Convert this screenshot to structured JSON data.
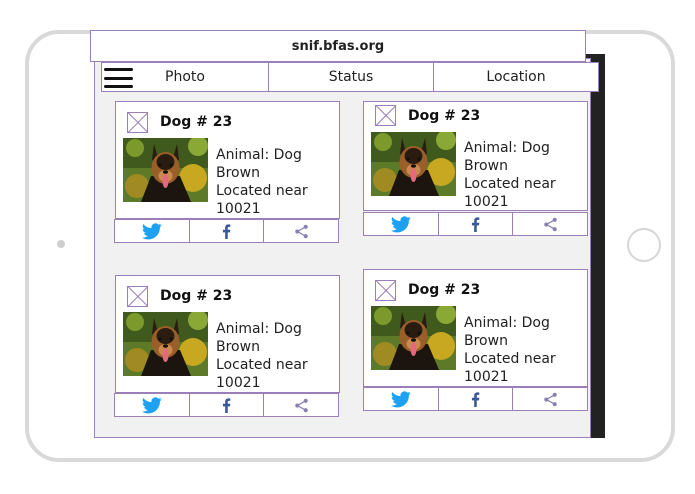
{
  "browser": {
    "url": "snif.bfas.org"
  },
  "nav": {
    "menu_icon": "hamburger-menu-icon",
    "tabs": [
      "Photo",
      "Status",
      "Location"
    ]
  },
  "cards": [
    {
      "title": "Dog # 23",
      "animal": "Animal: Dog",
      "color": "Brown",
      "located": "Located near",
      "zip": "10021"
    },
    {
      "title": "Dog # 23",
      "animal": "Animal: Dog",
      "color": "Brown",
      "located": "Located near",
      "zip": "10021"
    },
    {
      "title": "Dog # 23",
      "animal": "Animal: Dog",
      "color": "Brown",
      "located": "Located near",
      "zip": "10021"
    },
    {
      "title": "Dog # 23",
      "animal": "Animal: Dog",
      "color": "Brown",
      "located": "Located near",
      "zip": "10021"
    }
  ],
  "share_icons": [
    "twitter-icon",
    "facebook-icon",
    "share-icon"
  ],
  "colors": {
    "twitter": "#1da1f2",
    "facebook": "#3b5998",
    "share": "#8a7fb0",
    "frame": "#9a7fb8"
  }
}
